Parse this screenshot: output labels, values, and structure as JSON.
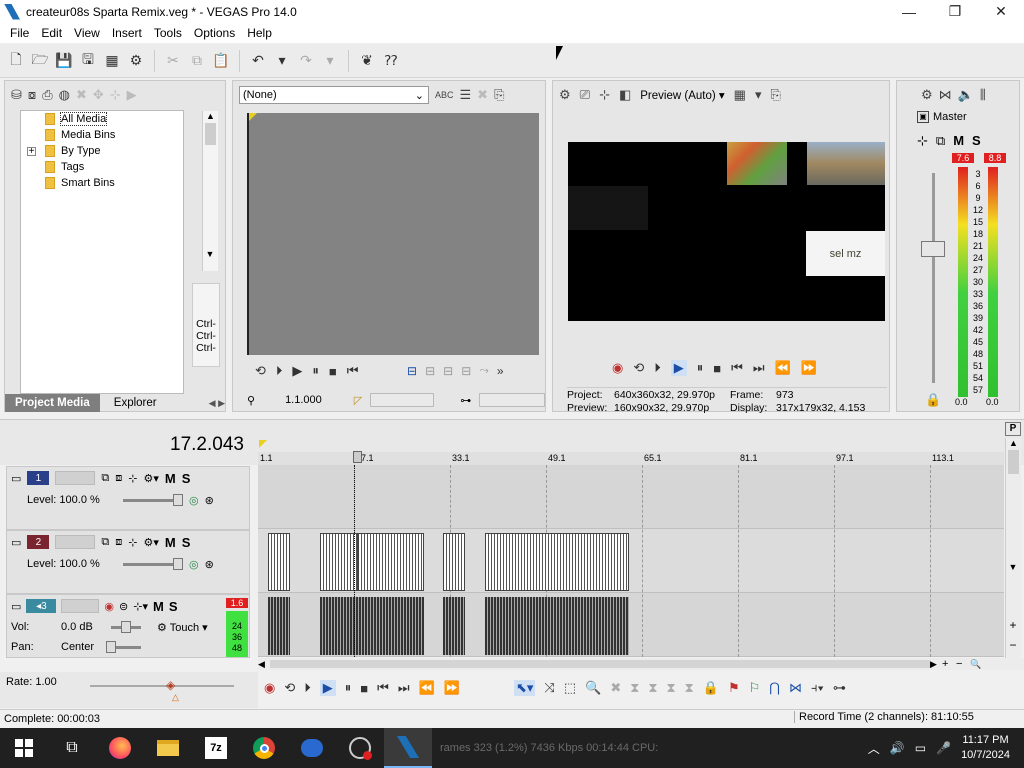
{
  "window": {
    "title": "createur08s Sparta Remix.veg * - VEGAS Pro 14.0",
    "minimize": "—",
    "maximize": "❐",
    "close": "✕"
  },
  "menu": [
    "File",
    "Edit",
    "View",
    "Insert",
    "Tools",
    "Options",
    "Help"
  ],
  "project_media": {
    "tree": [
      {
        "label": "All Media",
        "selected": true
      },
      {
        "label": "Media Bins"
      },
      {
        "label": "By Type",
        "expand": "+"
      },
      {
        "label": "Tags"
      },
      {
        "label": "Smart Bins"
      }
    ],
    "ctrl_labels": [
      "Ctrl-",
      "Ctrl-",
      "Ctrl-"
    ],
    "tabs": {
      "active": "Project Media",
      "other": "Explorer"
    }
  },
  "trimmer": {
    "dropdown_value": "(None)",
    "time": "1.1.000"
  },
  "preview": {
    "mode": "Preview (Auto)",
    "project_label": "Project:",
    "project_value": "640x360x32, 29.970p",
    "frame_label": "Frame:",
    "frame_value": "973",
    "preview_label": "Preview:",
    "preview_value": "160x90x32, 29.970p",
    "display_label": "Display:",
    "display_value": "317x179x32, 4.153",
    "overlay_text": "sel mz"
  },
  "master": {
    "label": "Master",
    "mute": "M",
    "solo": "S",
    "peak_left": "7.6",
    "peak_right": "8.8",
    "scale": [
      "3",
      "6",
      "9",
      "12",
      "15",
      "18",
      "21",
      "24",
      "27",
      "30",
      "33",
      "36",
      "39",
      "42",
      "45",
      "48",
      "51",
      "54",
      "57"
    ],
    "floor_left": "0.0",
    "floor_right": "0.0"
  },
  "timeline": {
    "cursor_time": "17.2.043",
    "ruler": [
      "1.1",
      "17.1",
      "33.1",
      "49.1",
      "65.1",
      "81.1",
      "97.1",
      "113.1"
    ],
    "tracks": [
      {
        "num": "1",
        "level": "Level: 100.0 %",
        "m": "M",
        "s": "S",
        "color": "#2a3f8a"
      },
      {
        "num": "2",
        "level": "Level: 100.0 %",
        "m": "M",
        "s": "S",
        "color": "#7a2430"
      },
      {
        "num": "3",
        "vol_label": "Vol:",
        "vol": "0.0 dB",
        "pan_label": "Pan:",
        "pan": "Center",
        "touch": "Touch",
        "m": "M",
        "s": "S",
        "peak": "1.6",
        "meter": [
          "24",
          "36",
          "48"
        ],
        "color": "#3a8aa0"
      }
    ],
    "rate": "Rate: 1.00"
  },
  "status": {
    "complete": "Complete: 00:00:03",
    "record": "Record Time (2 channels): 81:10:55"
  },
  "taskbar": {
    "time": "11:17 PM",
    "date": "10/7/2024",
    "ghost": "rames 323 (1.2%)   7436 Kbps   00:14:44   CPU:"
  }
}
